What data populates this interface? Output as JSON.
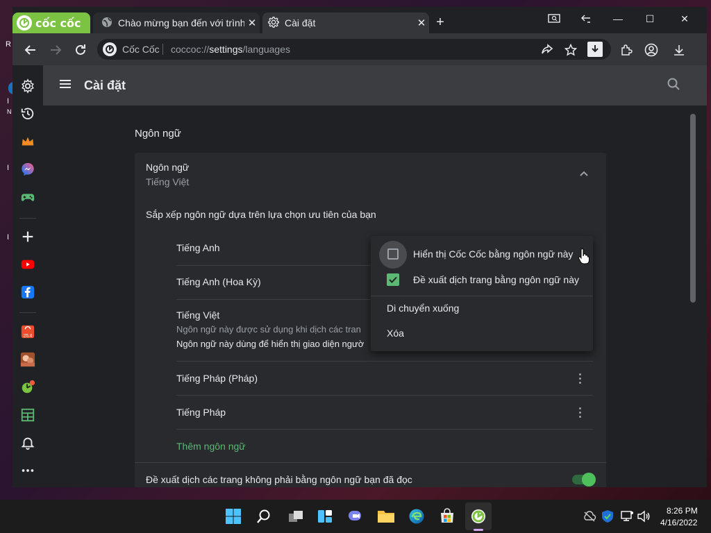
{
  "desktop": {
    "left_text": [
      "R",
      "I",
      "N",
      "I",
      "I"
    ]
  },
  "tabs": {
    "brand_label": "cốc cốc",
    "tab1_title": "Chào mừng bạn đến với trình",
    "tab2_title": "Cài đặt",
    "close_glyph": "✕",
    "new_tab_glyph": "+"
  },
  "window_controls": {
    "minimize": "—",
    "maximize": "☐",
    "close": "✕"
  },
  "omnibox": {
    "brand": "Cốc Cốc",
    "url_prefix": "coccoc://",
    "url_host": "settings",
    "url_path": "/languages"
  },
  "settings": {
    "title": "Cài đặt"
  },
  "languages": {
    "section_title": "Ngôn ngữ",
    "card_title": "Ngôn ngữ",
    "card_subtitle": "Tiếng Việt",
    "order_hint": "Sắp xếp ngôn ngữ dựa trên lựa chọn ưu tiên của bạn",
    "list": [
      {
        "name": "Tiếng Anh"
      },
      {
        "name": "Tiếng Anh (Hoa Kỳ)"
      },
      {
        "name": "Tiếng Việt",
        "note1": "Ngôn ngữ này được sử dụng khi dịch các tran",
        "note2": "Ngôn ngữ này dùng để hiển thị giao diện ngườ"
      },
      {
        "name": "Tiếng Pháp (Pháp)"
      },
      {
        "name": "Tiếng Pháp"
      }
    ],
    "add_language": "Thêm ngôn ngữ",
    "offer_translate": "Đề xuất dịch các trang không phải bằng ngôn ngữ bạn đã đọc",
    "offer_translate_on": true
  },
  "context_menu": {
    "display_in_lang": "Hiển thị Cốc Cốc bằng ngôn ngữ này",
    "display_in_lang_checked": false,
    "offer_translate": "Đề xuất dịch trang bằng ngôn ngữ này",
    "offer_translate_checked": true,
    "move_down": "Di chuyển xuống",
    "remove": "Xóa"
  },
  "taskbar": {
    "time": "8:26 PM",
    "date": "4/16/2022"
  },
  "colors": {
    "accent": "#5bb974",
    "brand_green": "#7cc243",
    "checkbox_green": "#5bb974"
  }
}
